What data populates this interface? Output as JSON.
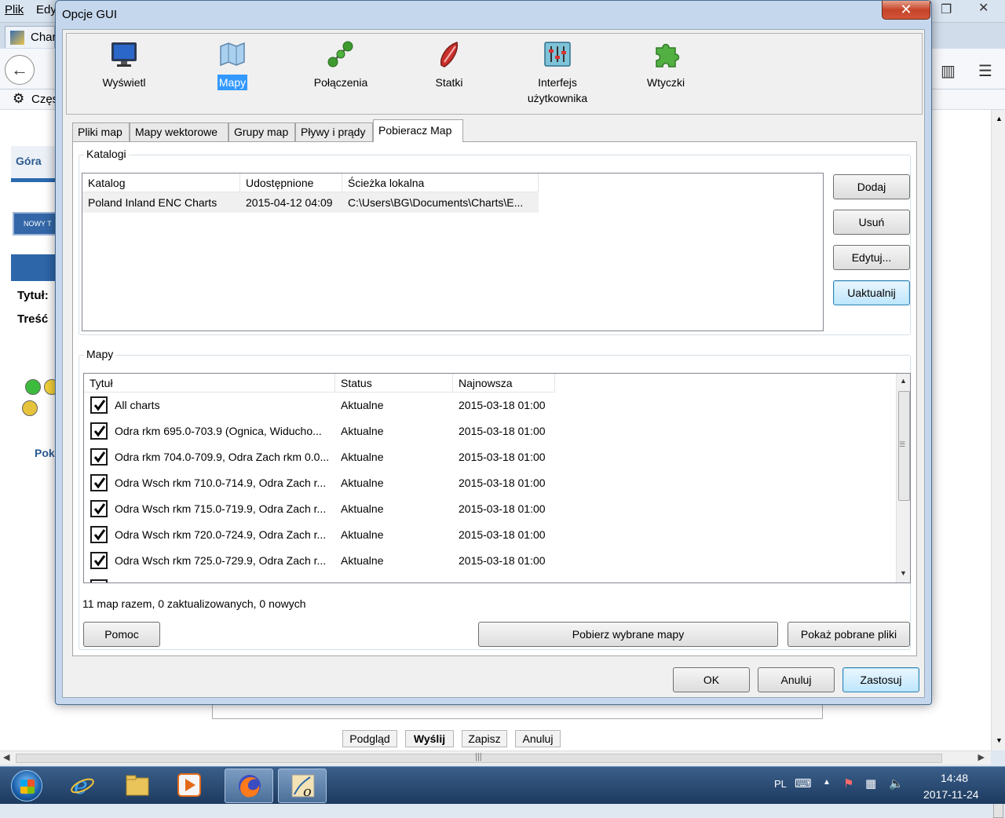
{
  "background_app": {
    "menu": [
      "Plik",
      "Edy"
    ],
    "tab_label": "Char",
    "bookmark_label": "Częs",
    "sidebar": {
      "gora": "Góra",
      "nowy": "NOWY T",
      "tytul": "Tytuł:",
      "tresc": "Treść",
      "pok": "Pok"
    },
    "actions": [
      "Podgląd",
      "Wyślij",
      "Zapisz",
      "Anuluj"
    ]
  },
  "dialog": {
    "title": "Opcje GUI",
    "close_glyph": "✕",
    "categories": [
      {
        "label": "Wyświetl",
        "icon": "monitor-icon"
      },
      {
        "label": "Mapy",
        "icon": "map-icon",
        "selected": true
      },
      {
        "label": "Połączenia",
        "icon": "connections-icon"
      },
      {
        "label": "Statki",
        "icon": "ship-icon"
      },
      {
        "label": "Interfejs użytkownika",
        "line1": "Interfejs",
        "line2": "użytkownika",
        "icon": "sliders-icon"
      },
      {
        "label": "Wtyczki",
        "icon": "puzzle-icon"
      }
    ],
    "tabs": [
      "Pliki map",
      "Mapy wektorowe",
      "Grupy map",
      "Pływy i prądy",
      "Pobieracz Map"
    ],
    "active_tab": "Pobieracz Map",
    "katalogi": {
      "title": "Katalogi",
      "columns": [
        "Katalog",
        "Udostępnione",
        "Ścieżka lokalna"
      ],
      "rows": [
        [
          "Poland Inland ENC Charts",
          "2015-04-12 04:09",
          "C:\\Users\\BG\\Documents\\Charts\\E..."
        ]
      ],
      "buttons": {
        "add": "Dodaj",
        "remove": "Usuń",
        "edit": "Edytuj...",
        "update": "Uaktualnij"
      }
    },
    "mapy": {
      "title": "Mapy",
      "columns": [
        "Tytuł",
        "Status",
        "Najnowsza"
      ],
      "rows": [
        {
          "checked": true,
          "title": "All charts",
          "status": "Aktualne",
          "latest": "2015-03-18 01:00"
        },
        {
          "checked": true,
          "title": "Odra rkm 695.0-703.9 (Ognica, Widucho...",
          "status": "Aktualne",
          "latest": "2015-03-18 01:00"
        },
        {
          "checked": true,
          "title": "Odra rkm 704.0-709.9, Odra Zach rkm 0.0...",
          "status": "Aktualne",
          "latest": "2015-03-18 01:00"
        },
        {
          "checked": true,
          "title": "Odra Wsch rkm 710.0-714.9, Odra Zach r...",
          "status": "Aktualne",
          "latest": "2015-03-18 01:00"
        },
        {
          "checked": true,
          "title": "Odra Wsch rkm 715.0-719.9, Odra Zach r...",
          "status": "Aktualne",
          "latest": "2015-03-18 01:00"
        },
        {
          "checked": true,
          "title": "Odra Wsch rkm 720.0-724.9, Odra Zach r...",
          "status": "Aktualne",
          "latest": "2015-03-18 01:00"
        },
        {
          "checked": true,
          "title": "Odra Wsch rkm 725.0-729.9, Odra Zach r...",
          "status": "Aktualne",
          "latest": "2015-03-18 01:00"
        }
      ],
      "summary": "11 map razem, 0 zaktualizowanych, 0 nowych"
    },
    "buttons": {
      "help": "Pomoc",
      "download": "Pobierz wybrane mapy",
      "show_downloaded": "Pokaż pobrane pliki",
      "ok": "OK",
      "cancel": "Anuluj",
      "apply": "Zastosuj"
    }
  },
  "taskbar": {
    "language": "PL",
    "time": "14:48",
    "date": "2017-11-24"
  },
  "colors": {
    "selection": "#3399ff",
    "close_button": "#c6442a",
    "taskbar": "#1d3a5f",
    "dialog_frame": "#c5d7ec"
  }
}
